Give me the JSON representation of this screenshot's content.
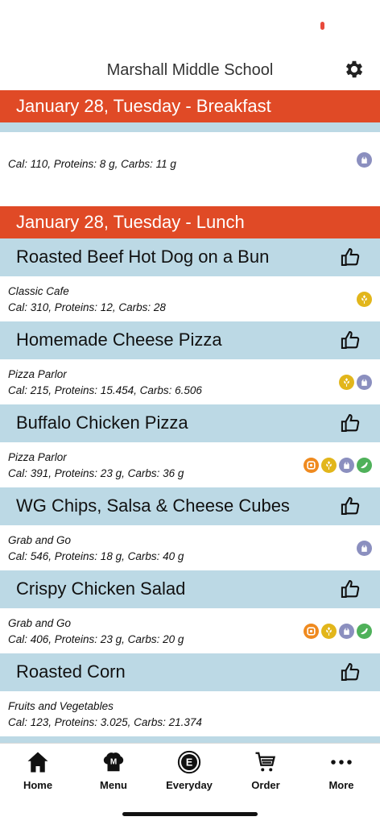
{
  "header": {
    "title": "Marshall Middle School"
  },
  "breakfast": {
    "heading": "January 28, Tuesday - Breakfast",
    "items": [
      {
        "station": "",
        "nutrition": "Cal: 110, Proteins: 8 g, Carbs: 11 g",
        "badges": [
          "veg"
        ]
      }
    ]
  },
  "lunch": {
    "heading": "January 28, Tuesday - Lunch",
    "items": [
      {
        "name": "Roasted Beef Hot Dog on a Bun",
        "station": "Classic Cafe",
        "nutrition": "Cal: 310, Proteins: 12, Carbs: 28",
        "badges": [
          "grain"
        ]
      },
      {
        "name": "Homemade Cheese Pizza",
        "station": "Pizza Parlor",
        "nutrition": "Cal: 215, Proteins: 15.454, Carbs: 6.506",
        "badges": [
          "grain",
          "veg"
        ]
      },
      {
        "name": "Buffalo Chicken Pizza",
        "station": "Pizza Parlor",
        "nutrition": "Cal: 391, Proteins: 23 g, Carbs: 36 g",
        "badges": [
          "orange",
          "grain",
          "veg",
          "green"
        ]
      },
      {
        "name": "WG Chips, Salsa & Cheese Cubes",
        "station": "Grab and Go",
        "nutrition": "Cal: 546, Proteins: 18 g, Carbs: 40 g",
        "badges": [
          "veg"
        ]
      },
      {
        "name": "Crispy Chicken Salad",
        "station": "Grab and Go",
        "nutrition": "Cal: 406, Proteins: 23 g, Carbs: 20 g",
        "badges": [
          "orange",
          "grain",
          "veg",
          "green"
        ]
      },
      {
        "name": "Roasted Corn",
        "station": "Fruits and Vegetables",
        "nutrition": "Cal: 123, Proteins: 3.025, Carbs: 21.374",
        "badges": []
      }
    ]
  },
  "tabs": [
    {
      "label": "Home",
      "icon": "home-icon"
    },
    {
      "label": "Menu",
      "icon": "chef-hat-icon"
    },
    {
      "label": "Everyday",
      "icon": "everyday-icon"
    },
    {
      "label": "Order",
      "icon": "cart-icon"
    },
    {
      "label": "More",
      "icon": "more-icon"
    }
  ],
  "colors": {
    "accent": "#e04a26",
    "item_bg": "#bcd9e5"
  }
}
